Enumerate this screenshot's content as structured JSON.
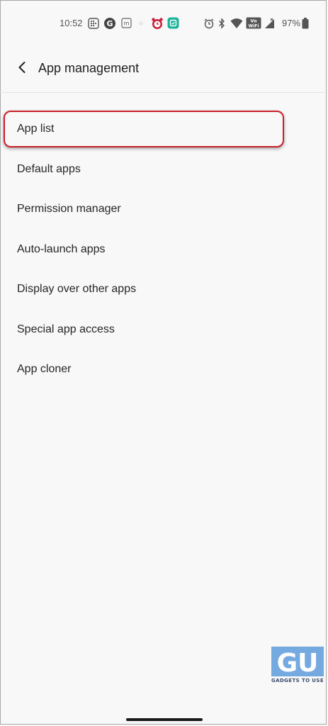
{
  "status_bar": {
    "time": "10:52",
    "battery": "97%",
    "volte_label": "Vo WiFi",
    "left_icons": [
      "grid-app-icon",
      "google-icon",
      "m-app-icon",
      "dot-icon",
      "alarm-app-icon",
      "green-app-icon"
    ],
    "right_icons": [
      "alarm-icon",
      "bluetooth-icon",
      "wifi-icon",
      "vowifi-icon",
      "signal-icon",
      "battery-icon"
    ]
  },
  "header": {
    "title": "App management"
  },
  "menu": {
    "items": [
      {
        "label": "App list"
      },
      {
        "label": "Default apps"
      },
      {
        "label": "Permission manager"
      },
      {
        "label": "Auto-launch apps"
      },
      {
        "label": "Display over other apps"
      },
      {
        "label": "Special app access"
      },
      {
        "label": "App cloner"
      }
    ],
    "highlighted_index": 0
  },
  "watermark": {
    "logo_text": "GU",
    "text": "GADGETS TO USE"
  },
  "colors": {
    "background": "#f8f8f8",
    "highlight": "#c8202a",
    "watermark": "#4a90d9"
  }
}
